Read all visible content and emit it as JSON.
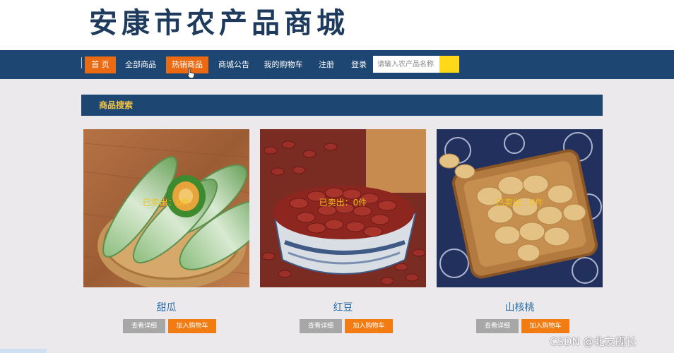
{
  "site": {
    "title": "安康市农产品商城"
  },
  "nav": {
    "items": [
      {
        "label": "首 页",
        "active": true
      },
      {
        "label": "全部商品",
        "active": false
      },
      {
        "label": "热销商品",
        "active": true
      },
      {
        "label": "商城公告",
        "active": false
      },
      {
        "label": "我的购物车",
        "active": false
      },
      {
        "label": "注册",
        "active": false
      },
      {
        "label": "登录",
        "active": false
      }
    ],
    "search": {
      "placeholder": "请输入农产品名称",
      "value": ""
    }
  },
  "section": {
    "title": "商品搜索"
  },
  "products": [
    {
      "name": "甜瓜",
      "sold_label": "已卖出：0件",
      "detail_label": "查看详细",
      "cart_label": "加入购物车",
      "icon": "melon-photo"
    },
    {
      "name": "红豆",
      "sold_label": "已卖出：0件",
      "detail_label": "查看详细",
      "cart_label": "加入购物车",
      "icon": "red-bean-photo"
    },
    {
      "name": "山核桃",
      "sold_label": "已卖出：0件",
      "detail_label": "查看详细",
      "cart_label": "加入购物车",
      "icon": "walnut-photo"
    }
  ],
  "watermark": "CSDN @北友舰长",
  "colors": {
    "nav_bg": "#1d4672",
    "active_tab": "#ec6a12",
    "search_button": "#ffd81a",
    "section_title": "#f5c645",
    "cart_button": "#f27b12",
    "detail_button": "#a7a7a7",
    "product_name": "#2a6fa6",
    "sold_label": "#f1c21b"
  }
}
